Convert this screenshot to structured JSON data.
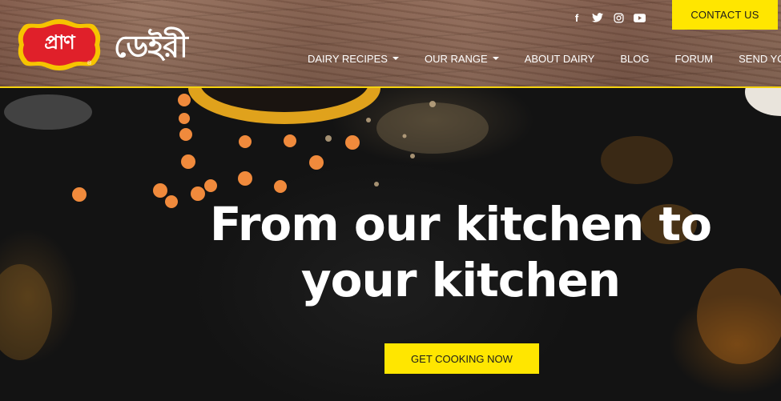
{
  "brand": {
    "logo_text": "প্রাণ",
    "registered_mark": "®",
    "name": "ডেইরী"
  },
  "social": [
    {
      "icon": "facebook-icon",
      "glyph": "f"
    },
    {
      "icon": "twitter-icon",
      "glyph": "🐦"
    },
    {
      "icon": "instagram-icon",
      "glyph": "◎"
    },
    {
      "icon": "youtube-icon",
      "glyph": "▶"
    }
  ],
  "header": {
    "contact_label": "CONTACT US"
  },
  "nav": {
    "items": [
      {
        "label": "DAIRY RECIPES",
        "dropdown": true
      },
      {
        "label": "OUR RANGE",
        "dropdown": true
      },
      {
        "label": "ABOUT DAIRY",
        "dropdown": false
      },
      {
        "label": "BLOG",
        "dropdown": false
      },
      {
        "label": "FORUM",
        "dropdown": false
      },
      {
        "label": "SEND YOUR R",
        "dropdown": false
      }
    ]
  },
  "hero": {
    "headline_line1": "From our kitchen to",
    "headline_line2": "your kitchen",
    "cta_label": "GET COOKING NOW"
  },
  "colors": {
    "accent": "#ffe600",
    "logo_red": "#e0202a",
    "logo_yellow": "#f6c400"
  }
}
